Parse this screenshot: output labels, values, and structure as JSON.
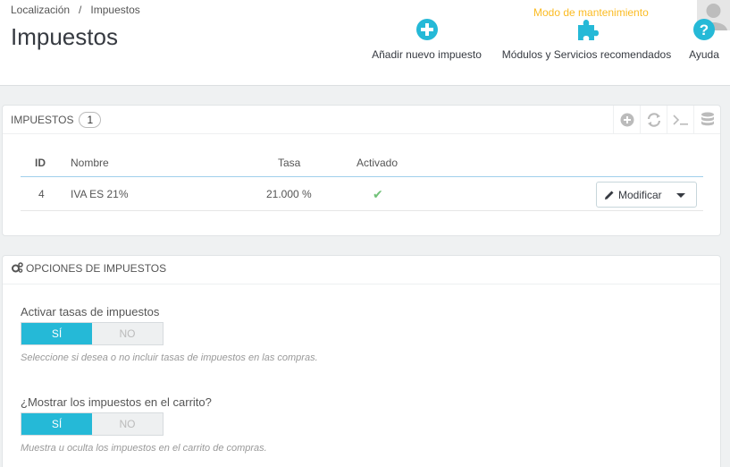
{
  "breadcrumb": {
    "parent": "Localización",
    "separator": "/",
    "current": "Impuestos"
  },
  "page_title": "Impuestos",
  "maintenance_label": "Modo de mantenimiento",
  "toolbar": {
    "add_tax": "Añadir nuevo impuesto",
    "modules": "Módulos y Servicios recomendados",
    "help": "Ayuda"
  },
  "taxes_panel": {
    "title": "IMPUESTOS",
    "count": "1",
    "columns": {
      "id": "ID",
      "name": "Nombre",
      "rate": "Tasa",
      "enabled": "Activado"
    },
    "rows": [
      {
        "id": "4",
        "name": "IVA ES 21%",
        "rate": "21.000 %",
        "enabled": "✔",
        "action": "Modificar"
      }
    ]
  },
  "options_panel": {
    "title": "OPCIONES DE IMPUESTOS",
    "options": [
      {
        "label": "Activar tasas de impuestos",
        "on": "SÍ",
        "off": "NO",
        "help": "Seleccione si desea o no incluir tasas de impuestos en las compras."
      },
      {
        "label": "¿Mostrar los impuestos en el carrito?",
        "on": "SÍ",
        "off": "NO",
        "help": "Muestra u oculta los impuestos en el carrito de compras."
      }
    ]
  },
  "colors": {
    "accent": "#25b9d7",
    "maintenance": "#fbbb22",
    "success": "#72c279"
  }
}
